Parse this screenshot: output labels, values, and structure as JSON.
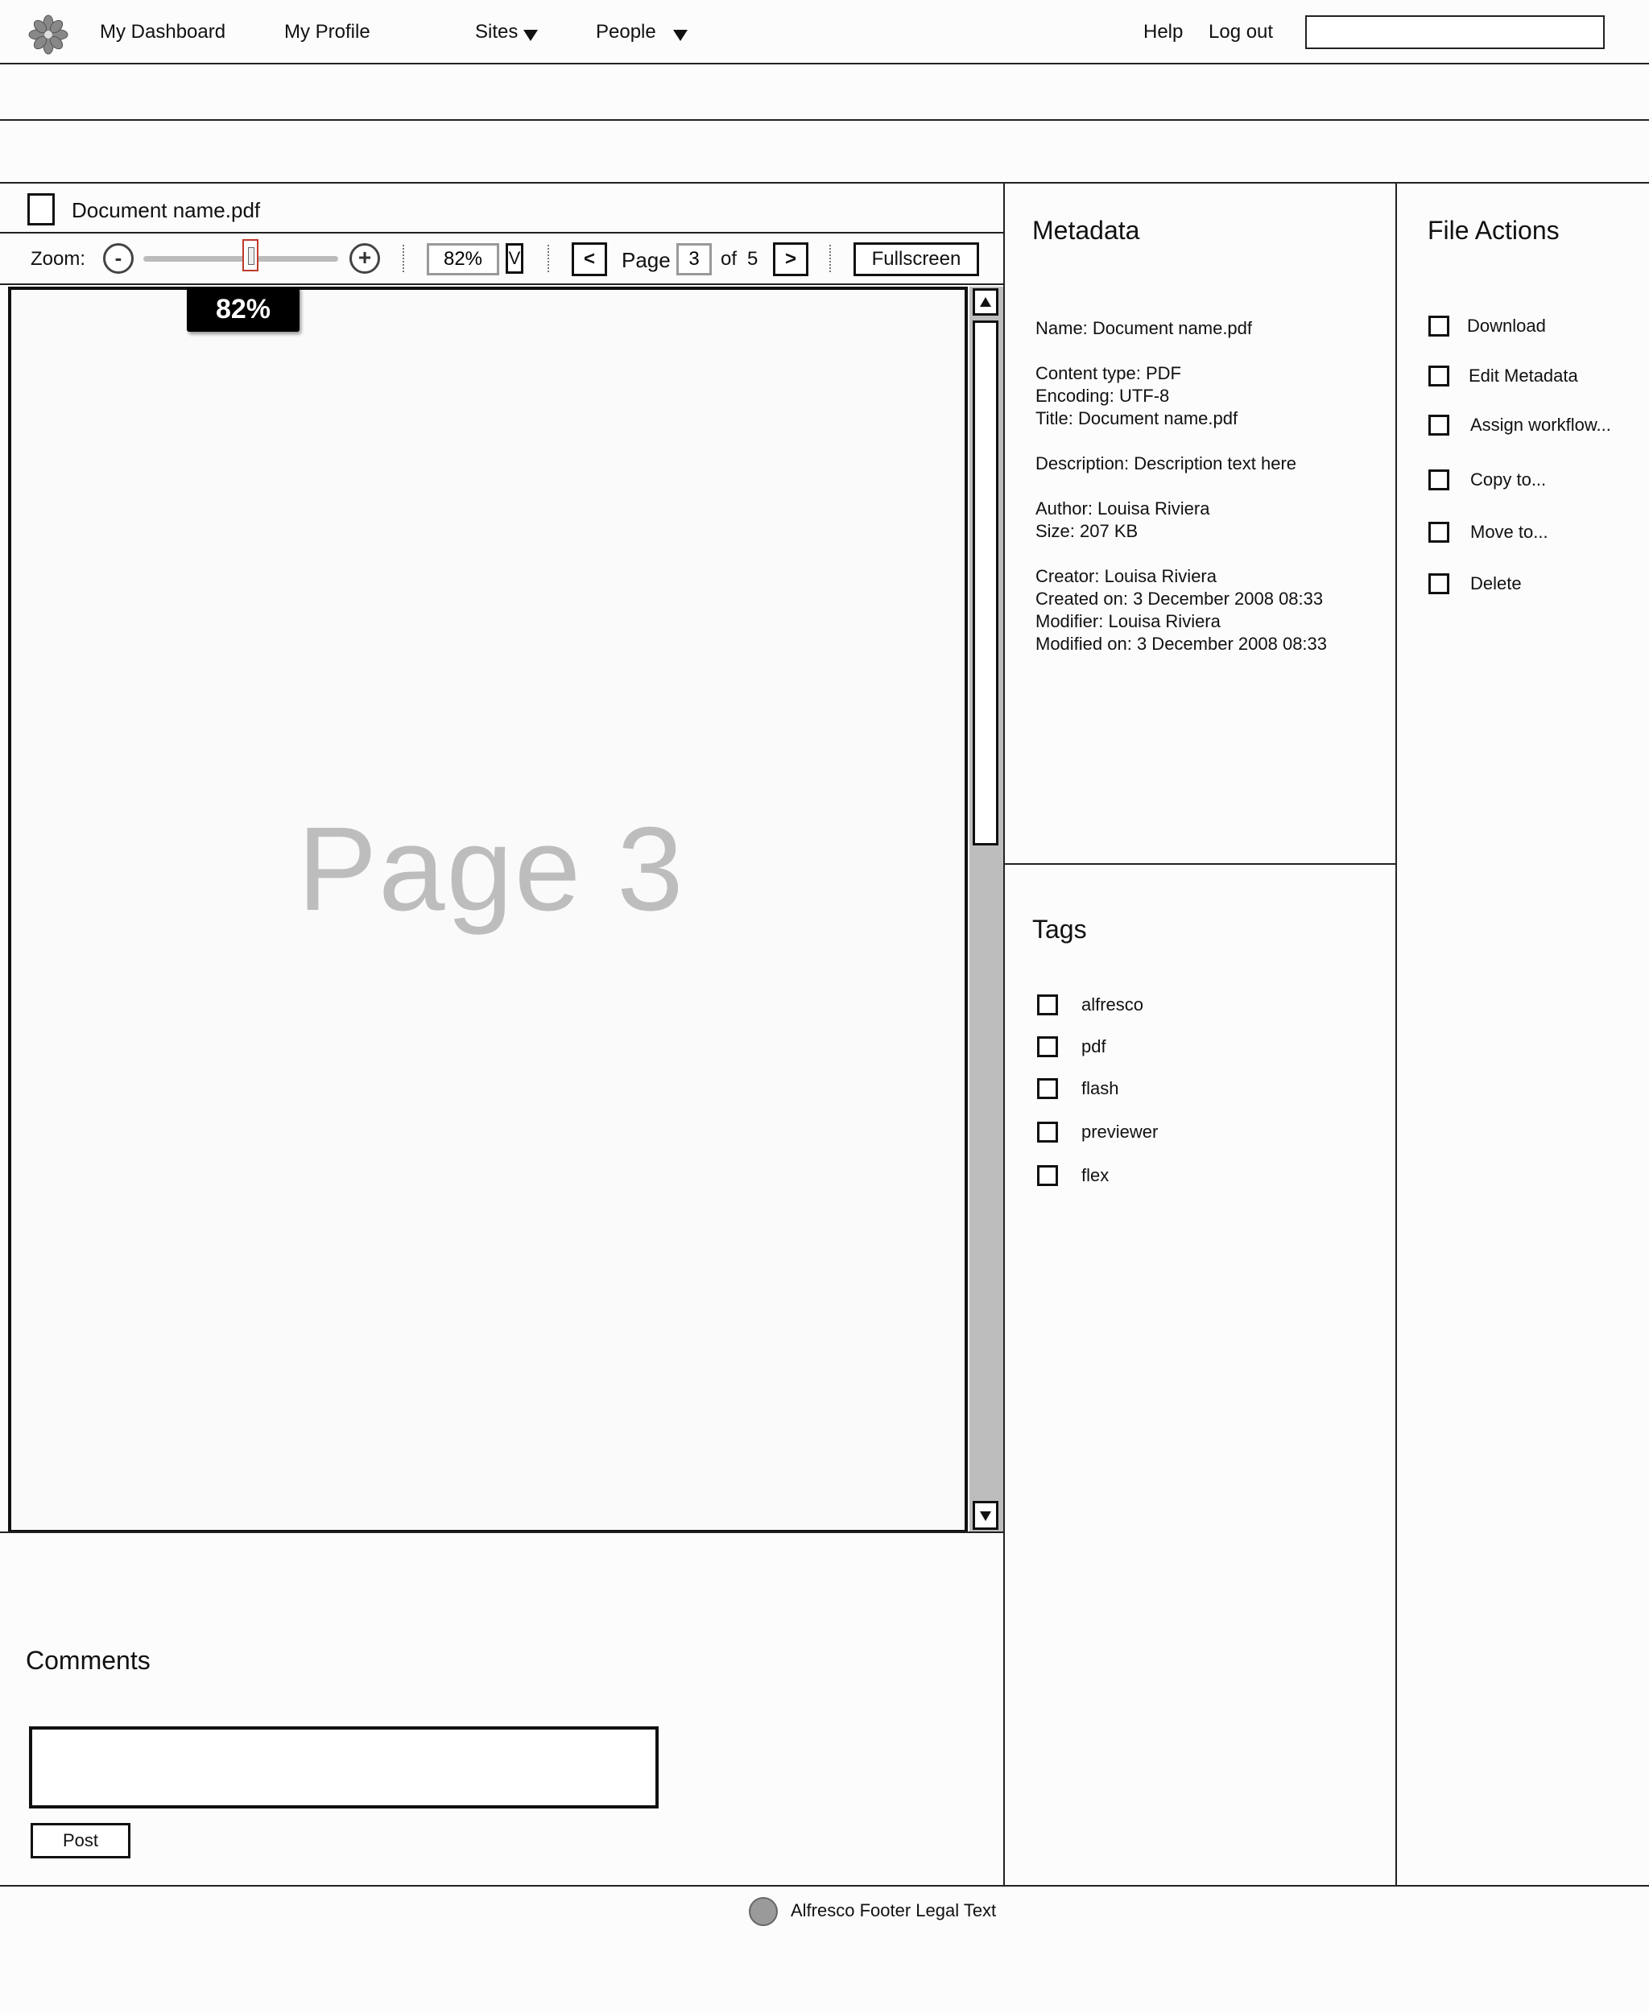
{
  "nav": {
    "items": [
      {
        "label": "My Dashboard"
      },
      {
        "label": "My Profile"
      },
      {
        "label": "Sites"
      },
      {
        "label": "People"
      }
    ],
    "help": "Help",
    "logout": "Log out",
    "search_value": ""
  },
  "document": {
    "name": "Document  name.pdf"
  },
  "toolbar": {
    "zoom_label": "Zoom:",
    "zoom_value": "82%",
    "zoom_fraction": 0.55,
    "zoom_tooltip": "82%",
    "zoom_dropdown": "V",
    "prev_label": "<",
    "next_label": ">",
    "page_label": "Page",
    "page_current": "3",
    "of_label": "of",
    "page_total": "5",
    "fullscreen_label": "Fullscreen"
  },
  "viewer": {
    "page_text": "Page 3"
  },
  "metadata": {
    "title": "Metadata",
    "lines": [
      "Name:  Document name.pdf",
      "Content type:  PDF",
      "Encoding: UTF-8",
      "Title: Document name.pdf",
      "Description: Description text here",
      "Author:  Louisa Riviera",
      "Size: 207 KB",
      "Creator: Louisa Riviera",
      "Created on: 3 December 2008 08:33",
      "Modifier: Louisa Riviera",
      "Modified on:  3 December 2008 08:33"
    ]
  },
  "tags": {
    "title": "Tags",
    "items": [
      "alfresco",
      "pdf",
      "flash",
      "previewer",
      "flex"
    ]
  },
  "file_actions": {
    "title": "File Actions",
    "items": [
      "Download",
      "Edit Metadata",
      "Assign workflow...",
      "Copy to...",
      "Move to...",
      "Delete"
    ]
  },
  "comments": {
    "title": "Comments",
    "input_value": "",
    "post_label": "Post"
  },
  "footer": {
    "text": "Alfresco Footer Legal Text"
  }
}
